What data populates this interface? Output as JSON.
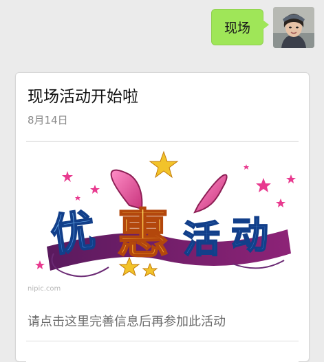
{
  "chat": {
    "outgoing_message": "现场"
  },
  "card": {
    "title": "现场活动开始啦",
    "date": "8月14日",
    "banner": {
      "main_text": "优惠活动",
      "watermark": "nipic.com"
    },
    "description": "请点击这里完善信息后再参加此活动"
  },
  "colors": {
    "bubble": "#9fe658",
    "background": "#ebebeb",
    "banner_pink": "#e8458c",
    "banner_orange": "#f7a51e",
    "banner_blue": "#2a6fd0"
  }
}
